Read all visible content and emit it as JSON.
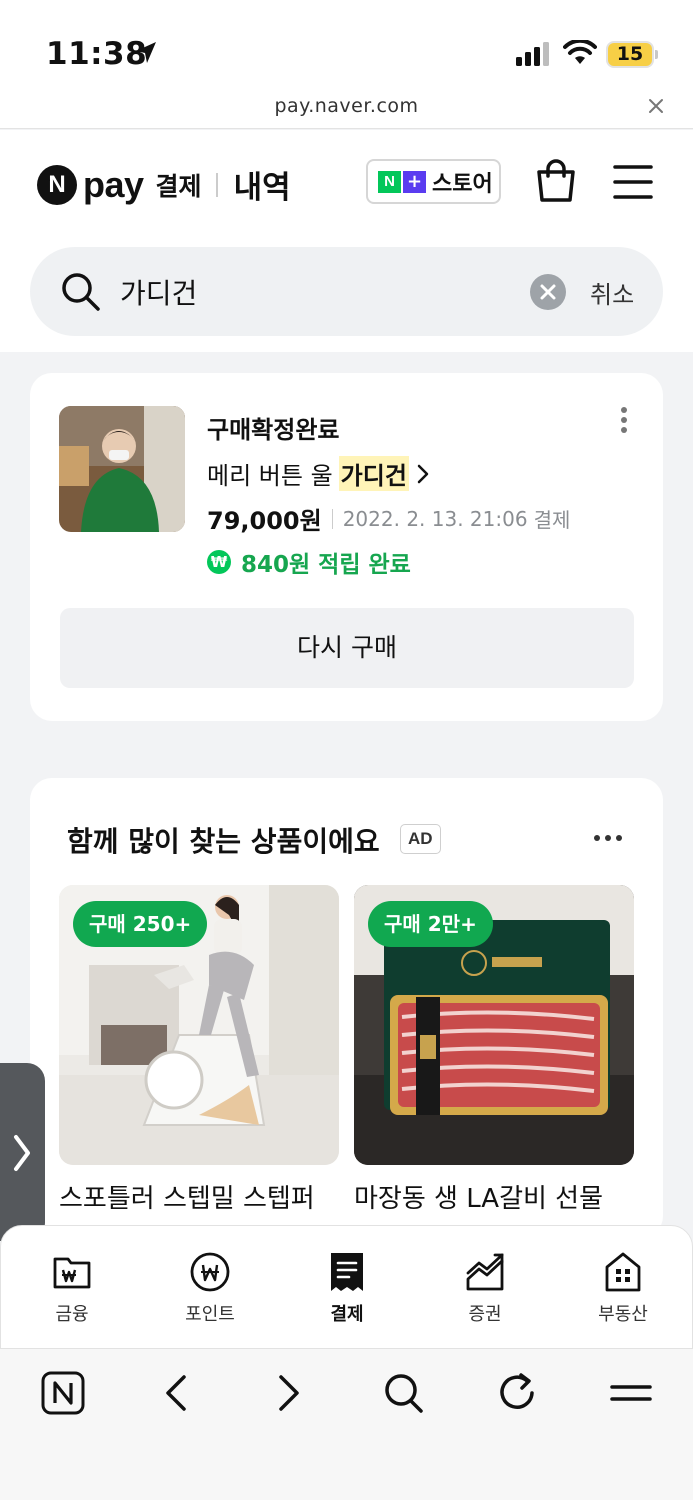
{
  "status_bar": {
    "time": "11:38",
    "battery": "15",
    "battery_level": 0.15
  },
  "url_bar": {
    "url": "pay.naver.com"
  },
  "header": {
    "logo_text": "pay",
    "logo_sub": "결제",
    "section": "내역",
    "store_label": "스토어"
  },
  "search": {
    "query": "가디건",
    "cancel_label": "취소"
  },
  "order": {
    "status": "구매확정완료",
    "product_prefix": "메리 버튼 울",
    "product_highlight": "가디건",
    "price": "79,000원",
    "date": "2022. 2. 13. 21:06",
    "pay_word": "결제",
    "points": "840원 적립 완료",
    "rebuy_label": "다시 구매"
  },
  "recommend": {
    "title": "함께 많이 찾는 상품이에요",
    "ad_label": "AD",
    "products": [
      {
        "badge": "구매 250+",
        "name": "스포틀러 스텝밀 스텝퍼"
      },
      {
        "badge": "구매 2만+",
        "name": "마장동 생 LA갈비 선물"
      }
    ]
  },
  "tabbar": {
    "tabs": [
      {
        "label": "금융",
        "icon": "wallet-icon"
      },
      {
        "label": "포인트",
        "icon": "point-icon"
      },
      {
        "label": "결제",
        "icon": "receipt-icon",
        "active": true
      },
      {
        "label": "증권",
        "icon": "stock-chart-icon"
      },
      {
        "label": "부동산",
        "icon": "building-icon"
      }
    ]
  },
  "colors": {
    "naver_green": "#03c75a",
    "badge_green": "#11a850",
    "highlight": "#fff4b8"
  }
}
